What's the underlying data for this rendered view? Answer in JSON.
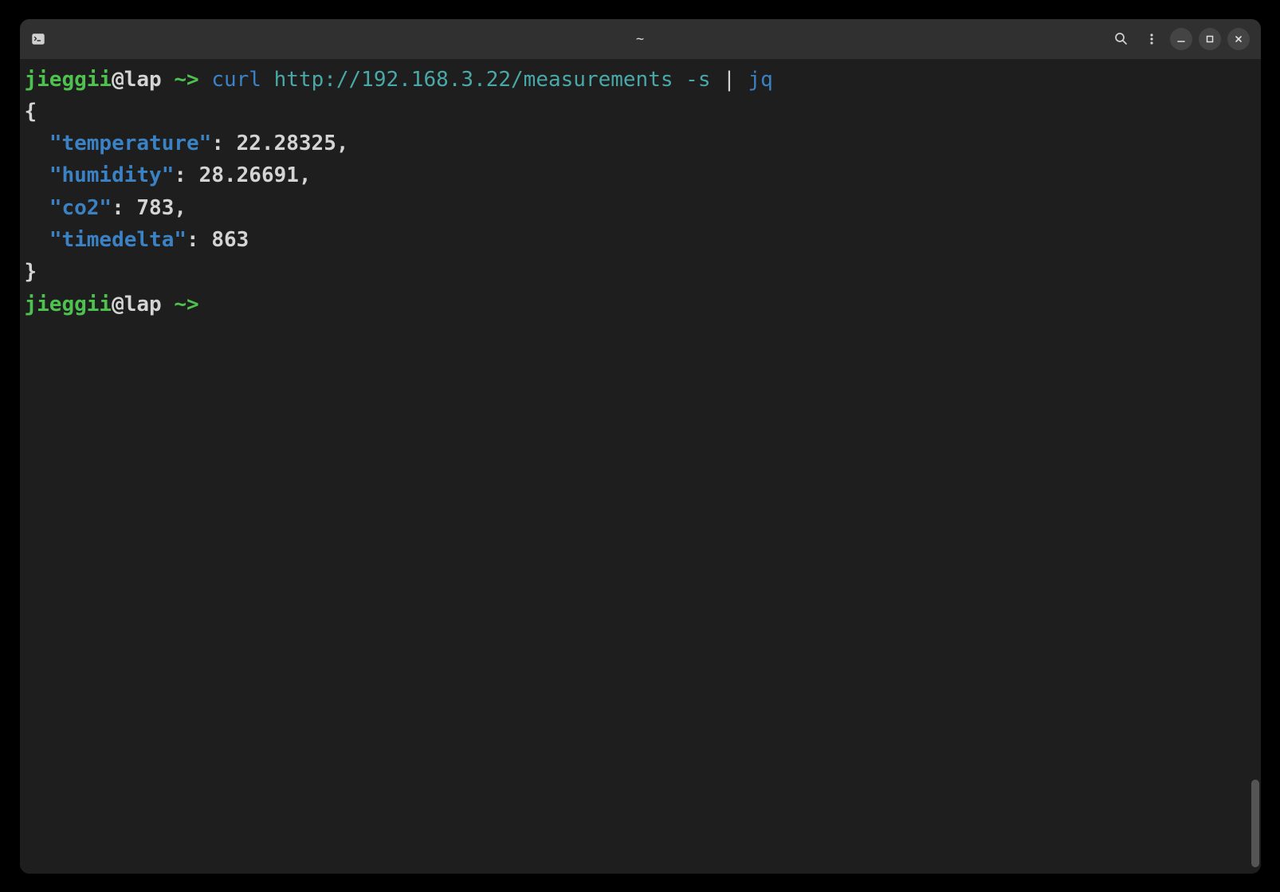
{
  "titlebar": {
    "title": "~"
  },
  "prompt": {
    "user": "jieggii",
    "at": "@",
    "host": "lap",
    "path": "~",
    "arrow": ">"
  },
  "command": {
    "cmd1": "curl",
    "url": "http://192.168.3.22/measurements",
    "flag": "-s",
    "pipe": "|",
    "cmd2": "jq"
  },
  "json": {
    "open": "{",
    "close": "}",
    "lines": [
      {
        "key": "\"temperature\"",
        "value": "22.28325",
        "comma": ","
      },
      {
        "key": "\"humidity\"",
        "value": "28.26691",
        "comma": ","
      },
      {
        "key": "\"co2\"",
        "value": "783",
        "comma": ","
      },
      {
        "key": "\"timedelta\"",
        "value": "863",
        "comma": ""
      }
    ]
  }
}
